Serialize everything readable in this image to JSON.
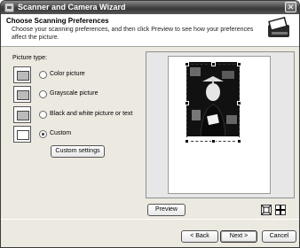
{
  "window": {
    "title": "Scanner and Camera Wizard",
    "close_glyph": "✕"
  },
  "header": {
    "title": "Choose Scanning Preferences",
    "subtitle": "Choose your scanning preferences, and then click Preview to see how your preferences affect the picture.",
    "icon": "scanner-wizard-icon"
  },
  "picture_type": {
    "label": "Picture type:",
    "options": [
      {
        "label": "Color picture",
        "selected": false,
        "icon": "color-picture-icon"
      },
      {
        "label": "Grayscale picture",
        "selected": false,
        "icon": "grayscale-picture-icon"
      },
      {
        "label": "Black and white picture or text",
        "selected": false,
        "icon": "black-white-picture-icon"
      },
      {
        "label": "Custom",
        "selected": true,
        "icon": "custom-settings-icon"
      }
    ],
    "custom_settings_label": "Custom settings"
  },
  "preview": {
    "preview_button_label": "Preview",
    "zoom_icon": "fit-to-window-icon",
    "crop_icon": "crop-icon"
  },
  "footer": {
    "back_label": "< Back",
    "next_label": "Next >",
    "cancel_label": "Cancel"
  }
}
